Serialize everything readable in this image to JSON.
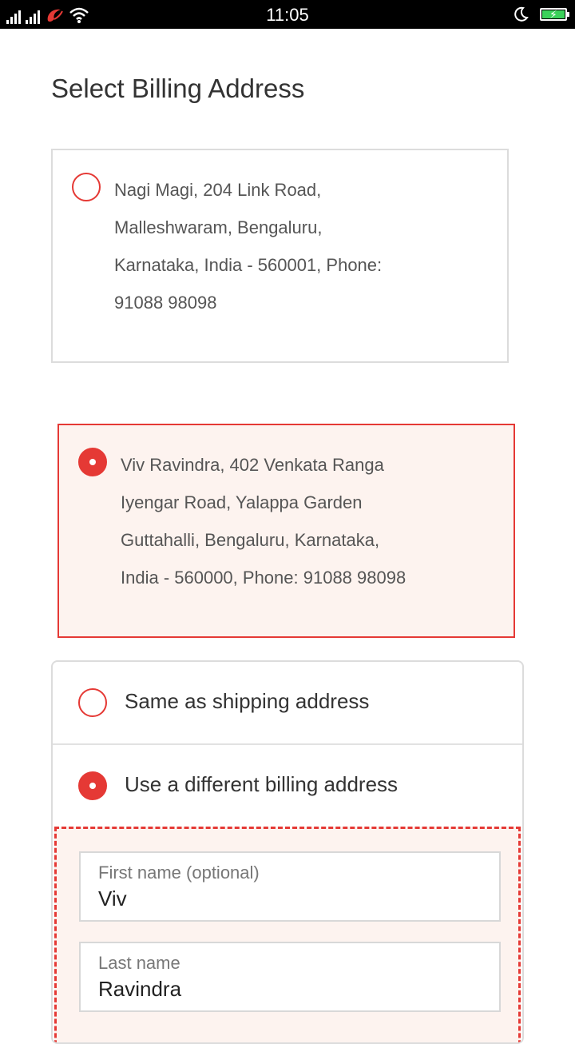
{
  "status_bar": {
    "time": "11:05",
    "icons": [
      "signal-icon",
      "signal-icon",
      "carrier-logo-icon",
      "wifi-icon",
      "moon-icon",
      "battery-charging-icon"
    ]
  },
  "page": {
    "title": "Select Billing Address"
  },
  "addresses": [
    {
      "selected": false,
      "lines": [
        "Nagi Magi, 204 Link Road,",
        "Malleshwaram, Bengaluru,",
        "Karnataka, India - 560001, Phone:",
        "91088 98098"
      ]
    },
    {
      "selected": true,
      "lines": [
        "Viv Ravindra, 402 Venkata Ranga",
        "Iyengar Road, Yalappa Garden",
        "Guttahalli, Bengaluru, Karnataka,",
        "India - 560000, Phone: 91088 98098"
      ]
    }
  ],
  "billing_options": [
    {
      "label": "Same as shipping address",
      "selected": false
    },
    {
      "label": "Use a different billing address",
      "selected": true
    }
  ],
  "form": {
    "first_name": {
      "label": "First name (optional)",
      "value": "Viv"
    },
    "last_name": {
      "label": "Last name",
      "value": "Ravindra"
    }
  },
  "colors": {
    "accent": "#e53935",
    "selected_bg": "#fdf3ef",
    "border": "#dcdcdc"
  }
}
